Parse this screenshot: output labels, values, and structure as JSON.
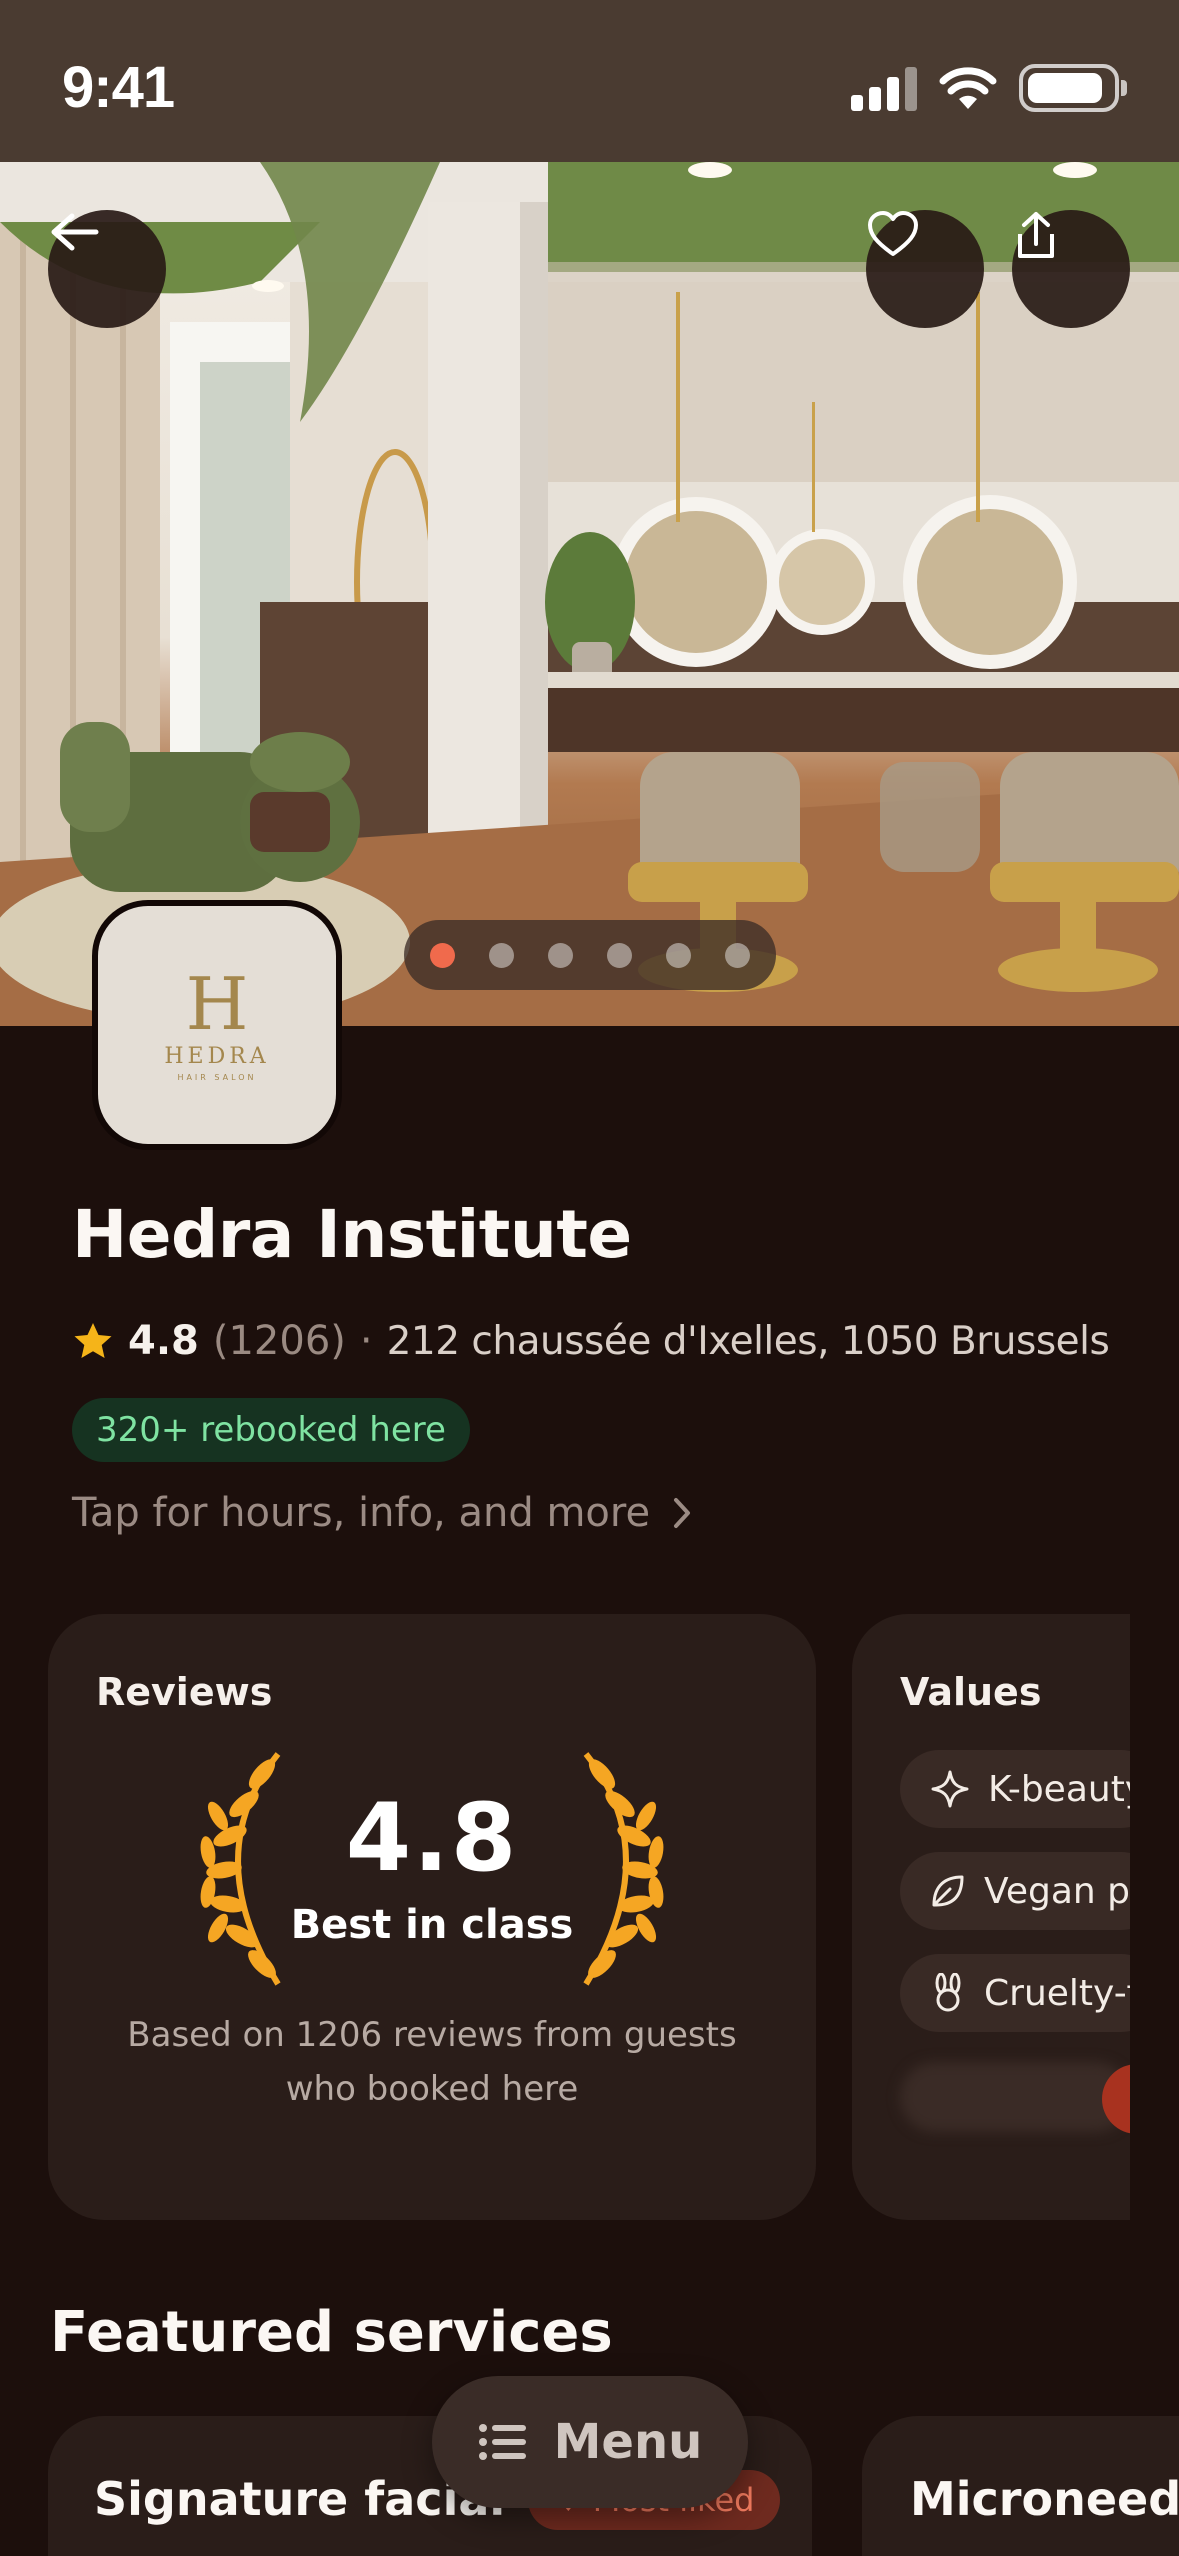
{
  "status_bar": {
    "time": "9:41"
  },
  "hero": {
    "image_alt": "salon interior",
    "carousel_count": 6,
    "active_index": 0
  },
  "logo": {
    "mark": "H",
    "name": "HEDRA",
    "sub": "HAIR SALON"
  },
  "venue": {
    "name": "Hedra Institute",
    "rating": "4.8",
    "review_count": "(1206)",
    "separator": "·",
    "address": "212 chaussée d'Ixelles, 1050 Brussels",
    "rebooked": "320+ rebooked here",
    "more_link": "Tap for hours, info, and more"
  },
  "reviews_card": {
    "title": "Reviews",
    "score": "4.8",
    "tagline": "Best in class",
    "based_on": "Based on 1206 reviews from guests who booked here"
  },
  "values_card": {
    "title": "Values",
    "chips": [
      {
        "icon": "sparkle-icon",
        "label": "K-beauty"
      },
      {
        "icon": "leaf-icon",
        "label": "Vegan products"
      },
      {
        "icon": "rabbit-icon",
        "label": "Cruelty-free"
      }
    ]
  },
  "featured": {
    "title": "Featured services",
    "services": [
      {
        "name": "Signature facial",
        "badge": "Most liked"
      },
      {
        "name": "Microneedling",
        "badge": ""
      }
    ]
  },
  "menu_button": {
    "label": "Menu"
  },
  "colors": {
    "accent": "#f06a4c",
    "background": "#1c0f0c",
    "card": "#2a1d19",
    "rebooked_text": "#7fe3a2",
    "gold": "#f5a623"
  }
}
